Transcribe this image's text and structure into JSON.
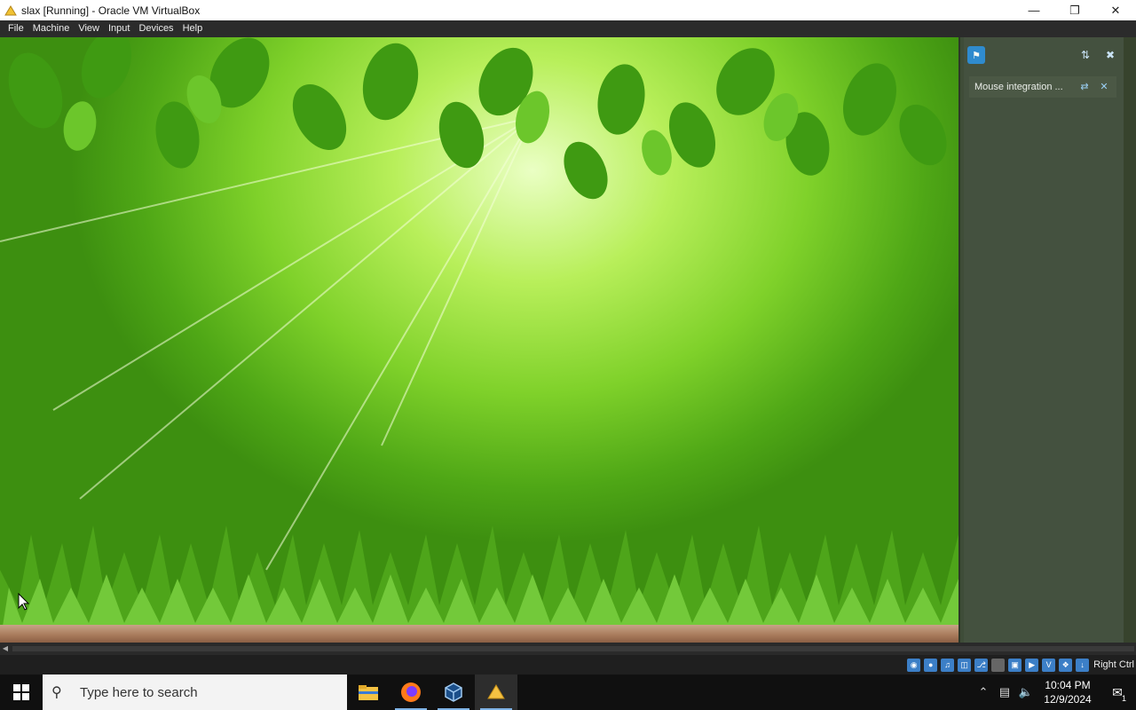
{
  "window": {
    "title": "slax [Running] - Oracle VM VirtualBox",
    "minimize": "—",
    "restore": "❐",
    "close": "✕"
  },
  "menu": {
    "items": [
      "File",
      "Machine",
      "View",
      "Input",
      "Devices",
      "Help"
    ]
  },
  "notifications": {
    "message": "Mouse integration ...",
    "host_key_label": "Right Ctrl"
  },
  "taskbar": {
    "search_placeholder": "Type here to search",
    "time": "10:04 PM",
    "date": "12/9/2024",
    "notification_count": "1"
  },
  "colors": {
    "titlebar_bg": "#ffffff",
    "menubar_bg": "#2b2b2b",
    "taskbar_bg": "#101010",
    "accent": "#7fb3e6"
  }
}
